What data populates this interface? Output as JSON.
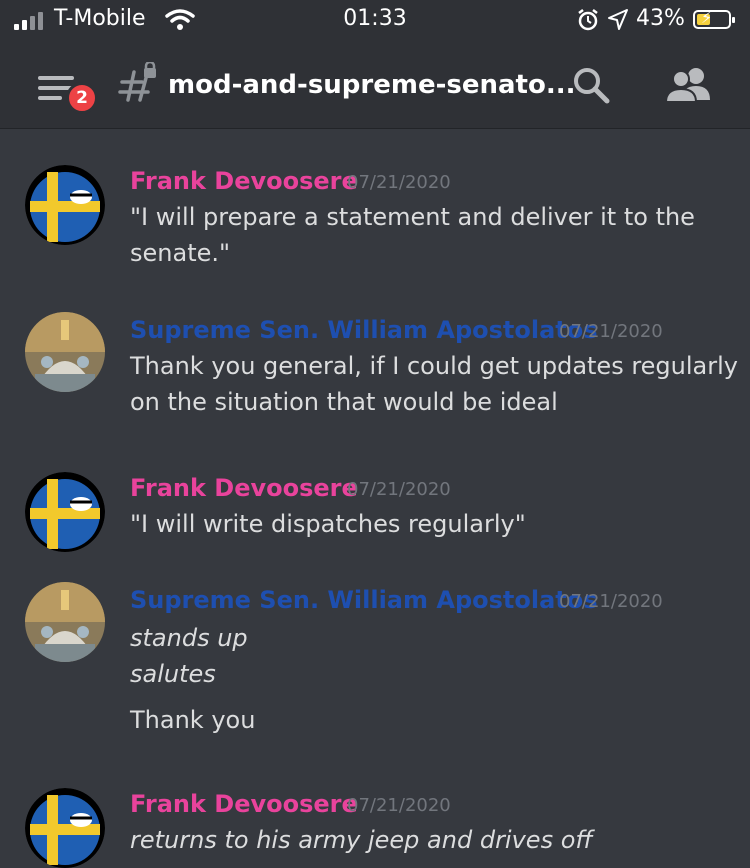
{
  "status_bar": {
    "carrier": "T-Mobile",
    "time": "01:33",
    "battery_percent": "43%",
    "battery_level": 0.43
  },
  "header": {
    "unread_badge": "2",
    "channel_name": "mod-and-supreme-senato..."
  },
  "colors": {
    "frank": "#e9439c",
    "william": "#1e4fb0",
    "background": "#36393f",
    "header_bg": "#2f3136"
  },
  "messages": [
    {
      "author": "Frank Devoosere",
      "timestamp": "07/21/2020",
      "lines": [
        "\"I will prepare a statement and deliver it to the",
        "senate.\""
      ]
    },
    {
      "author": "Supreme Sen. William Apostolatos",
      "timestamp": "07/21/2020",
      "lines": [
        "Thank you general, if I could get updates regularly",
        "on the situation that would be ideal"
      ]
    },
    {
      "author": "Frank Devoosere",
      "timestamp": "07/21/2020",
      "lines": [
        "\"I will write dispatches regularly\""
      ]
    },
    {
      "author": "Supreme Sen. William Apostolatos",
      "timestamp": "07/21/2020",
      "lines": [
        "stands up",
        "salutes",
        "Thank you"
      ]
    },
    {
      "author": "Frank Devoosere",
      "timestamp": "07/21/2020",
      "lines": [
        "returns to his army jeep and drives off"
      ]
    }
  ]
}
